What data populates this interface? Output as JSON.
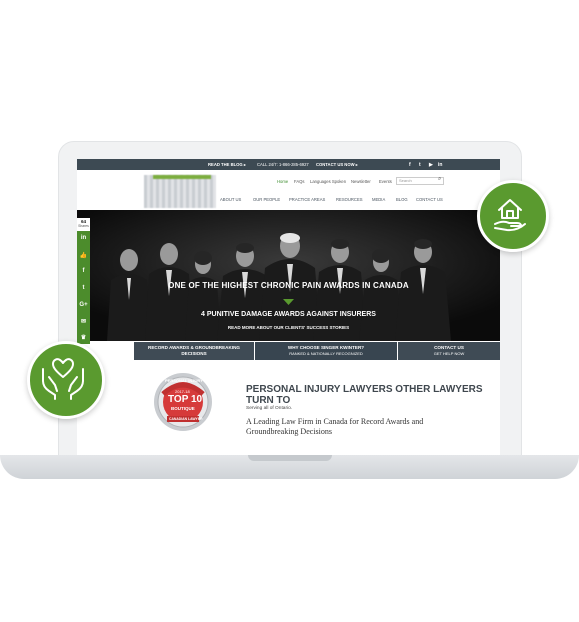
{
  "topbar": {
    "read_blog": "READ THE BLOG ▸",
    "call": "CALL 24/7: 1-866-285-6927",
    "contact_now": "CONTACT US NOW ▸",
    "social": [
      "f",
      "t",
      "▶",
      "in"
    ]
  },
  "header": {
    "util_links": [
      "Home",
      "FAQs",
      "Languages Spoken",
      "Newsletter",
      "Events"
    ],
    "search_placeholder": "Search",
    "nav": [
      "ABOUT US",
      "OUR PEOPLE",
      "PRACTICE AREAS",
      "RESOURCES",
      "MEDIA",
      "BLOG",
      "CONTACT US"
    ]
  },
  "hero": {
    "title": "ONE OF THE HIGHEST CHRONIC PAIN AWARDS IN CANADA",
    "subtitle": "4 PUNITIVE DAMAGE AWARDS AGAINST INSURERS",
    "link": "READ MORE ABOUT OUR CLIENTS' SUCCESS STORIES"
  },
  "features": [
    {
      "title": "RECORD AWARDS & GROUNDBREAKING",
      "sub": "DECISIONS"
    },
    {
      "title": "WHY CHOOSE SINGER KWINTER?",
      "sub": "RANKED & NATIONALLY RECOGNIZED"
    },
    {
      "title": "CONTACT US",
      "sub": "GET HELP NOW"
    }
  ],
  "share": {
    "count": "64",
    "label": "Shares",
    "buttons": [
      "in",
      "👍",
      "f",
      "t",
      "G+",
      "✉",
      "♛"
    ]
  },
  "badge": {
    "top_text": "PERSONAL INJURY",
    "year": "2017-18",
    "big": "TOP 10",
    "small": "BOUTIQUE",
    "bottom": "CANADIAN LAWYER"
  },
  "content": {
    "title_line1": "PERSONAL INJURY LAWYERS OTHER LAWYERS",
    "title_line2": "TURN TO",
    "serving": "Serving all of Ontario.",
    "lead": "A Leading Law Firm in Canada for Record Awards and Groundbreaking Decisions"
  },
  "colors": {
    "accent_green": "#5a9a2f",
    "topbar": "#3d4a53",
    "feature_bar": "#3f4b55"
  },
  "icons": [
    "house-hand-icon",
    "heart-hands-icon"
  ]
}
